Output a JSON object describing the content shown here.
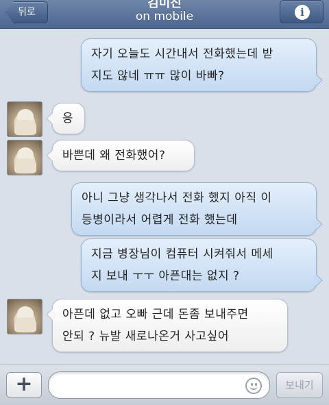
{
  "header": {
    "back_label": "뒤로",
    "contact_name": "김미진",
    "contact_status": "on mobile",
    "info_glyph": "i",
    "info_icon": "info-icon"
  },
  "messages": [
    {
      "direction": "out",
      "lines": [
        "자기 오늘도 시간내서 전화했는데 받",
        "지도 않네 ㅠㅠ 많이 바빠?"
      ]
    },
    {
      "direction": "in",
      "lines": [
        "응"
      ]
    },
    {
      "direction": "in",
      "lines": [
        "바쁜데 왜 전화했어?"
      ]
    },
    {
      "direction": "out",
      "lines": [
        "아니 그냥 생각나서 전화 했지 아직 이",
        "등병이라서 어렵게 전화 했는데"
      ]
    },
    {
      "direction": "out",
      "lines": [
        "지금 병장님이 컴퓨터 시켜줘서 메세",
        "지 보내 ㅜㅜ 아픈대는 없지 ?"
      ]
    },
    {
      "direction": "in",
      "lines": [
        "아픈데 없고 오빠 근데 돈좀 보내주면",
        "안되 ? 뉴발 새로나온거 사고싶어"
      ]
    }
  ],
  "input_bar": {
    "plus_label": "+",
    "text_value": "",
    "smiley_icon": "smiley-icon",
    "send_label": "보내기"
  },
  "colors": {
    "header": "#4d6690",
    "outgoing_bubble": "#c3d9f1",
    "incoming_bubble": "#ffffff",
    "background": "#d9e0ea"
  }
}
